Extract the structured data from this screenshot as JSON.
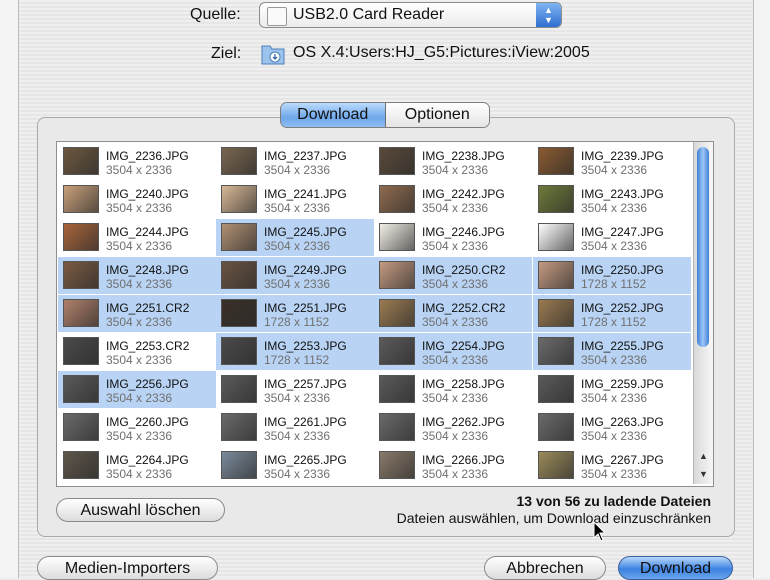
{
  "source": {
    "label": "Quelle:",
    "value": "USB2.0 Card Reader"
  },
  "destination": {
    "label": "Ziel:",
    "path": "OS X.4:Users:HJ_G5:Pictures:iView:2005"
  },
  "tabs": [
    {
      "label": "Download",
      "selected": true
    },
    {
      "label": "Optionen",
      "selected": false
    }
  ],
  "files": [
    {
      "name": "IMG_2236.JPG",
      "dims": "3504 x 2336",
      "selected": false,
      "thumb": "#6e5840"
    },
    {
      "name": "IMG_2237.JPG",
      "dims": "3504 x 2336",
      "selected": false,
      "thumb": "#7a6650"
    },
    {
      "name": "IMG_2238.JPG",
      "dims": "3504 x 2336",
      "selected": false,
      "thumb": "#5a4a3a"
    },
    {
      "name": "IMG_2239.JPG",
      "dims": "3504 x 2336",
      "selected": false,
      "thumb": "#8a5a30"
    },
    {
      "name": "IMG_2240.JPG",
      "dims": "3504 x 2336",
      "selected": false,
      "thumb": "#c9a07a"
    },
    {
      "name": "IMG_2241.JPG",
      "dims": "3504 x 2336",
      "selected": false,
      "thumb": "#d8b896"
    },
    {
      "name": "IMG_2242.JPG",
      "dims": "3504 x 2336",
      "selected": false,
      "thumb": "#8f6b4e"
    },
    {
      "name": "IMG_2243.JPG",
      "dims": "3504 x 2336",
      "selected": false,
      "thumb": "#6d7a3a"
    },
    {
      "name": "IMG_2244.JPG",
      "dims": "3504 x 2336",
      "selected": false,
      "thumb": "#a8643a"
    },
    {
      "name": "IMG_2245.JPG",
      "dims": "3504 x 2336",
      "selected": true,
      "thumb": "#b08f72"
    },
    {
      "name": "IMG_2246.JPG",
      "dims": "3504 x 2336",
      "selected": false,
      "thumb": "#f2efe6"
    },
    {
      "name": "IMG_2247.JPG",
      "dims": "3504 x 2336",
      "selected": false,
      "thumb": "#ffffff"
    },
    {
      "name": "IMG_2248.JPG",
      "dims": "3504 x 2336",
      "selected": true,
      "thumb": "#7a5a42"
    },
    {
      "name": "IMG_2249.JPG",
      "dims": "3504 x 2336",
      "selected": true,
      "thumb": "#6a5442"
    },
    {
      "name": "IMG_2250.CR2",
      "dims": "3504 x 2336",
      "selected": true,
      "thumb": "#c49a80"
    },
    {
      "name": "IMG_2250.JPG",
      "dims": "1728 x 1152",
      "selected": true,
      "thumb": "#c49a80"
    },
    {
      "name": "IMG_2251.CR2",
      "dims": "3504 x 2336",
      "selected": true,
      "thumb": "#b0806a"
    },
    {
      "name": "IMG_2251.JPG",
      "dims": "1728 x 1152",
      "selected": true,
      "thumb": "#3a3028"
    },
    {
      "name": "IMG_2252.CR2",
      "dims": "3504 x 2336",
      "selected": true,
      "thumb": "#9a7a50"
    },
    {
      "name": "IMG_2252.JPG",
      "dims": "1728 x 1152",
      "selected": true,
      "thumb": "#9a7a50"
    },
    {
      "name": "IMG_2253.CR2",
      "dims": "3504 x 2336",
      "selected": false,
      "thumb": "#4a4a4a"
    },
    {
      "name": "IMG_2253.JPG",
      "dims": "1728 x 1152",
      "selected": true,
      "thumb": "#4a4a4a"
    },
    {
      "name": "IMG_2254.JPG",
      "dims": "3504 x 2336",
      "selected": true,
      "thumb": "#5a5a5a"
    },
    {
      "name": "IMG_2255.JPG",
      "dims": "3504 x 2336",
      "selected": true,
      "thumb": "#6a6a6a"
    },
    {
      "name": "IMG_2256.JPG",
      "dims": "3504 x 2336",
      "selected": true,
      "thumb": "#5a5a5a"
    },
    {
      "name": "IMG_2257.JPG",
      "dims": "3504 x 2336",
      "selected": false,
      "thumb": "#5a5a5a"
    },
    {
      "name": "IMG_2258.JPG",
      "dims": "3504 x 2336",
      "selected": false,
      "thumb": "#5a5a5a"
    },
    {
      "name": "IMG_2259.JPG",
      "dims": "3504 x 2336",
      "selected": false,
      "thumb": "#5a5a5a"
    },
    {
      "name": "IMG_2260.JPG",
      "dims": "3504 x 2336",
      "selected": false,
      "thumb": "#6a6a6a"
    },
    {
      "name": "IMG_2261.JPG",
      "dims": "3504 x 2336",
      "selected": false,
      "thumb": "#6a6a6a"
    },
    {
      "name": "IMG_2262.JPG",
      "dims": "3504 x 2336",
      "selected": false,
      "thumb": "#6a6a6a"
    },
    {
      "name": "IMG_2263.JPG",
      "dims": "3504 x 2336",
      "selected": false,
      "thumb": "#6a6a6a"
    },
    {
      "name": "IMG_2264.JPG",
      "dims": "3504 x 2336",
      "selected": false,
      "thumb": "#5e564a"
    },
    {
      "name": "IMG_2265.JPG",
      "dims": "3504 x 2336",
      "selected": false,
      "thumb": "#7a8a9a"
    },
    {
      "name": "IMG_2266.JPG",
      "dims": "3504 x 2336",
      "selected": false,
      "thumb": "#8a7a6a"
    },
    {
      "name": "IMG_2267.JPG",
      "dims": "3504 x 2336",
      "selected": false,
      "thumb": "#9a8a5a"
    }
  ],
  "clear_selection_label": "Auswahl löschen",
  "status": {
    "count": "13 von 56 zu ladende Dateien",
    "hint": "Dateien auswählen, um Download einzuschränken"
  },
  "footer": {
    "media_button": "Medien-Importers",
    "cancel_button": "Abbrechen",
    "download_button": "Download"
  },
  "colors": {
    "selection": "#b8d3f3",
    "accent": "#3d82e0"
  }
}
